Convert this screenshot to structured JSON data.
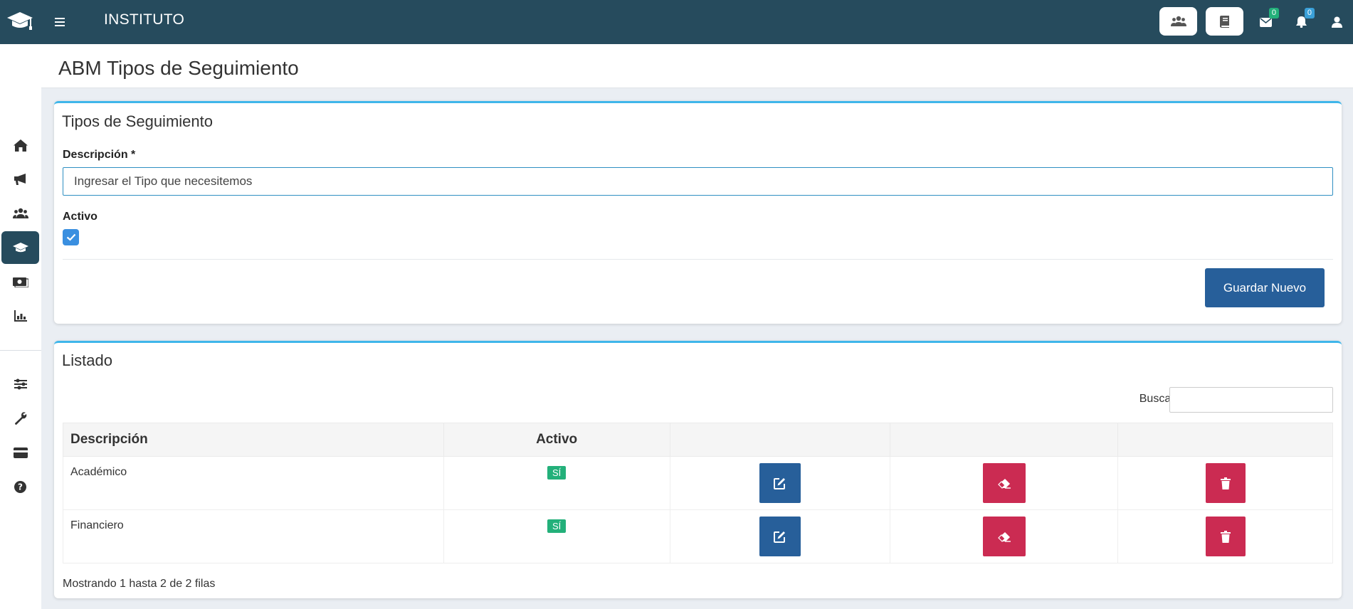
{
  "topbar": {
    "brand": "INSTITUTO",
    "mail_count": "0",
    "notif_count": "0",
    "icons": [
      "graduation-cap",
      "menu",
      "users",
      "book",
      "envelope",
      "bell",
      "user"
    ]
  },
  "sidebar": {
    "items": [
      "home",
      "bullhorn",
      "users",
      "graduation-cap",
      "money",
      "chart"
    ],
    "bottom_items": [
      "sliders",
      "wrench",
      "credit-card",
      "question"
    ],
    "active": "graduation-cap"
  },
  "header": {
    "title": "ABM Tipos de Seguimiento"
  },
  "form": {
    "title": "Tipos de Seguimiento",
    "description_label": "Descripción *",
    "description_value": "Ingresar el Tipo que necesitemos",
    "active_label": "Activo",
    "active_checked": true,
    "save_label": "Guardar Nuevo"
  },
  "list": {
    "title": "Listado",
    "search_label": "Buscar:",
    "search_value": "",
    "columns": [
      "Descripción",
      "Activo",
      "",
      "",
      ""
    ],
    "rows": [
      {
        "description": "Académico",
        "active": "SÍ"
      },
      {
        "description": "Financiero",
        "active": "SÍ"
      }
    ],
    "footer": "Mostrando 1 hasta 2 de 2 filas"
  },
  "colors": {
    "topbar": "#264b5d",
    "accent": "#3fb6ea",
    "primary": "#275f9a",
    "danger": "#cb2b52",
    "success": "#23b07a",
    "mail_badge": "#23b07a",
    "notif_badge": "#3aa0d8"
  }
}
